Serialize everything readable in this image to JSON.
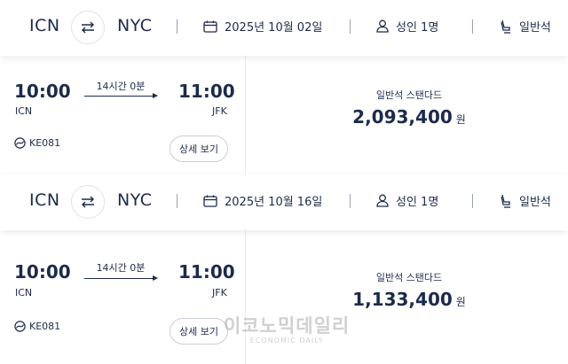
{
  "searches": [
    {
      "header": {
        "origin": "ICN",
        "destination": "NYC",
        "date": "2025년 10월 02일",
        "passengers": "성인 1명",
        "cabin": "일반석"
      },
      "flight": {
        "departure_time": "10:00",
        "departure_airport": "ICN",
        "duration": "14시간 0분",
        "arrival_time": "11:00",
        "arrival_airport": "JFK",
        "flight_number": "KE081",
        "detail_button": "상세 보기",
        "fare_class": "일반석 스탠다드",
        "price": "2,093,400",
        "currency": "원"
      }
    },
    {
      "header": {
        "origin": "ICN",
        "destination": "NYC",
        "date": "2025년 10월 16일",
        "passengers": "성인 1명",
        "cabin": "일반석"
      },
      "flight": {
        "departure_time": "10:00",
        "departure_airport": "ICN",
        "duration": "14시간 0분",
        "arrival_time": "11:00",
        "arrival_airport": "JFK",
        "flight_number": "KE081",
        "detail_button": "상세 보기",
        "fare_class": "일반석 스탠다드",
        "price": "1,133,400",
        "currency": "원"
      }
    }
  ],
  "watermark": {
    "main": "이코노믹데일리",
    "sub": "ECONOMIC DAILY"
  },
  "colors": {
    "text": "#1c2b4b",
    "background": "#f4f5f8",
    "card": "#ffffff"
  },
  "icons": [
    "swap-icon",
    "calendar-icon",
    "person-icon",
    "seat-icon",
    "airline-logo-icon"
  ]
}
